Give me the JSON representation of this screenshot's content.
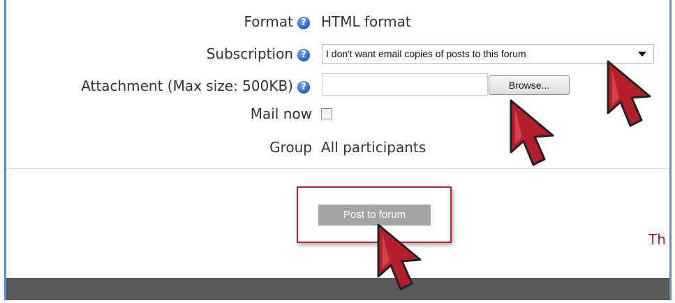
{
  "form": {
    "format_label": "Format",
    "format_value": "HTML format",
    "subscription_label": "Subscription",
    "subscription_value": "I don't want email copies of posts to this forum",
    "attachment_label": "Attachment (Max size: 500KB)",
    "browse_label": "Browse...",
    "mail_now_label": "Mail now",
    "group_label": "Group",
    "group_value": "All participants",
    "help_glyph": "?"
  },
  "actions": {
    "post_button_label": "Post to forum"
  },
  "partial_text": "Th",
  "colors": {
    "frame_border": "#5b8ec9",
    "help_icon": "#1f5fc0",
    "highlight_box": "#b5232e",
    "post_button": "#a4a4a4",
    "footer_bar": "#595959",
    "cursor_fill": "#b51f2a"
  }
}
